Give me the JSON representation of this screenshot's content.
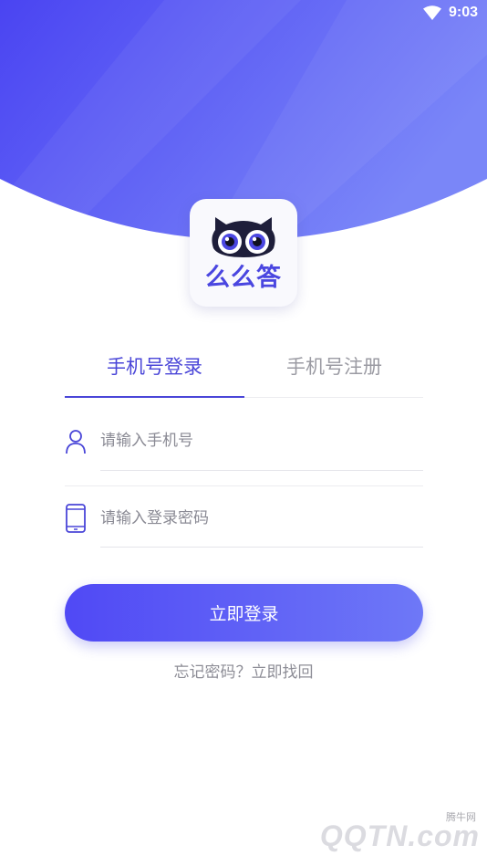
{
  "status_bar": {
    "time": "9:03",
    "wifi_icon": "wifi-icon"
  },
  "theme": {
    "accent": "#4a46d8",
    "header_start": "#4a44f2",
    "header_end": "#7a86f8",
    "button_start": "#5049f5",
    "button_end": "#6e78f7"
  },
  "logo": {
    "text": "么么答",
    "icon": "owl-face-icon"
  },
  "tabs": [
    {
      "label": "手机号登录",
      "active": true
    },
    {
      "label": "手机号注册",
      "active": false
    }
  ],
  "form": {
    "phone": {
      "placeholder": "请输入手机号",
      "value": "",
      "icon": "user-icon"
    },
    "password": {
      "placeholder": "请输入登录密码",
      "value": "",
      "icon": "mobile-phone-icon"
    }
  },
  "login_button": {
    "label": "立即登录"
  },
  "forgot": {
    "text": "忘记密码？立即找回"
  },
  "watermark": {
    "brand": "QQTN.com",
    "site": "腾牛网"
  }
}
